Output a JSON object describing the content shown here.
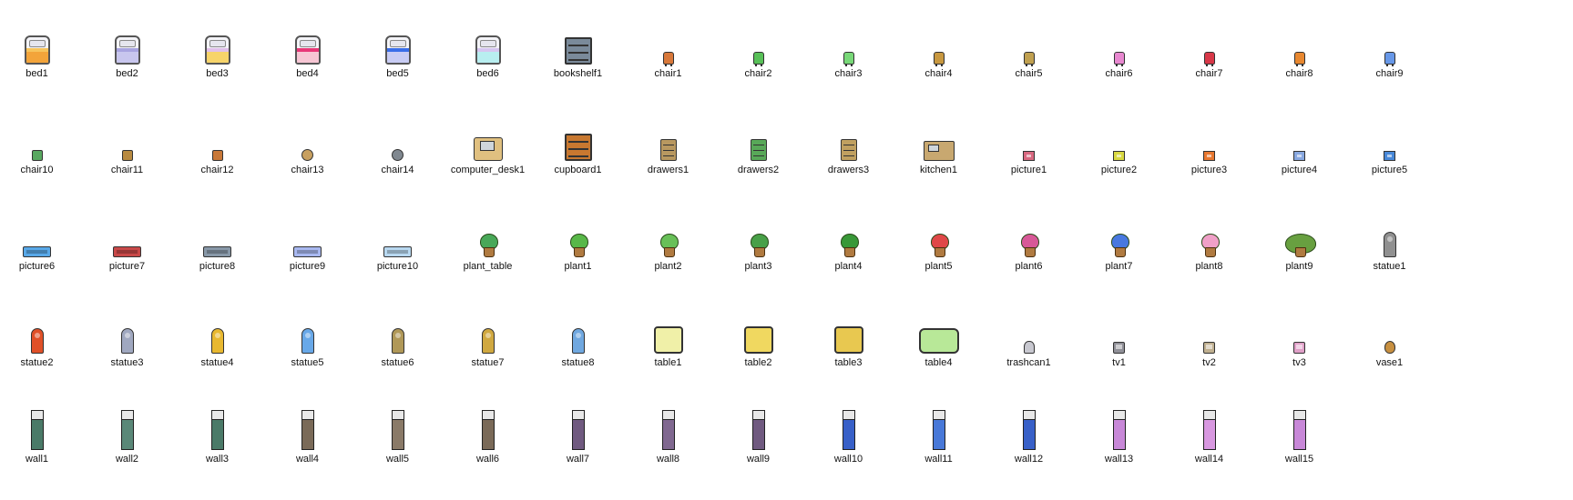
{
  "rows": [
    [
      {
        "label": "bed1",
        "icon": "bed",
        "color": "#f3a43a",
        "accent": "#f7c45c"
      },
      {
        "label": "bed2",
        "icon": "bed",
        "color": "#c8c6ee",
        "accent": "#a8a4e0"
      },
      {
        "label": "bed3",
        "icon": "bed",
        "color": "#f7d46a",
        "accent": "#e0c0ea"
      },
      {
        "label": "bed4",
        "icon": "bed",
        "color": "#f7c6d4",
        "accent": "#e83878"
      },
      {
        "label": "bed5",
        "icon": "bed",
        "color": "#c8ccf4",
        "accent": "#3a6ee8"
      },
      {
        "label": "bed6",
        "icon": "bed",
        "color": "#b8eef0",
        "accent": "#d6c6f0"
      },
      {
        "label": "bookshelf1",
        "icon": "bookshelf",
        "color": "#7a8a9a"
      },
      {
        "label": "chair1",
        "icon": "chair",
        "color": "#d8783a"
      },
      {
        "label": "chair2",
        "icon": "chair",
        "color": "#58c058"
      },
      {
        "label": "chair3",
        "icon": "chair",
        "color": "#78d878"
      },
      {
        "label": "chair4",
        "icon": "chair",
        "color": "#c89840"
      },
      {
        "label": "chair5",
        "icon": "chair",
        "color": "#c0a050"
      },
      {
        "label": "chair6",
        "icon": "chair",
        "color": "#e888d0"
      },
      {
        "label": "chair7",
        "icon": "chair",
        "color": "#d83848"
      },
      {
        "label": "chair8",
        "icon": "chair",
        "color": "#e88830"
      },
      {
        "label": "chair9",
        "icon": "chair",
        "color": "#6898e8"
      }
    ],
    [
      {
        "label": "chair10",
        "icon": "small",
        "color": "#58a860"
      },
      {
        "label": "chair11",
        "icon": "small",
        "color": "#b88a40"
      },
      {
        "label": "chair12",
        "icon": "small",
        "color": "#c87838"
      },
      {
        "label": "chair13",
        "icon": "round",
        "color": "#c8a060"
      },
      {
        "label": "chair14",
        "icon": "round",
        "color": "#808890"
      },
      {
        "label": "computer_desk1",
        "icon": "desk",
        "color": "#e0c080"
      },
      {
        "label": "cupboard1",
        "icon": "shelf",
        "color": "#c87830"
      },
      {
        "label": "drawers1",
        "icon": "cabinet",
        "color": "#b89860"
      },
      {
        "label": "drawers2",
        "icon": "cabinet",
        "color": "#58a858"
      },
      {
        "label": "drawers3",
        "icon": "cabinet",
        "color": "#c0a060"
      },
      {
        "label": "kitchen1",
        "icon": "kitchen",
        "color": "#c8a870"
      },
      {
        "label": "picture1",
        "icon": "frame",
        "color": "#d86880"
      },
      {
        "label": "picture2",
        "icon": "frame",
        "color": "#d8d840"
      },
      {
        "label": "picture3",
        "icon": "frame",
        "color": "#e87830"
      },
      {
        "label": "picture4",
        "icon": "frame",
        "color": "#88a8e0"
      },
      {
        "label": "picture5",
        "icon": "frame",
        "color": "#4888d8"
      }
    ],
    [
      {
        "label": "picture6",
        "icon": "wide",
        "color": "#58a8e8"
      },
      {
        "label": "picture7",
        "icon": "wide",
        "color": "#c84848"
      },
      {
        "label": "picture8",
        "icon": "wide",
        "color": "#8898a8"
      },
      {
        "label": "picture9",
        "icon": "wide",
        "color": "#a8b8f0"
      },
      {
        "label": "picture10",
        "icon": "wide",
        "color": "#b8d8f0"
      },
      {
        "label": "plant_table",
        "icon": "plant",
        "color": "#48a858"
      },
      {
        "label": "plant1",
        "icon": "plant",
        "color": "#58b848"
      },
      {
        "label": "plant2",
        "icon": "plant",
        "color": "#68c058"
      },
      {
        "label": "plant3",
        "icon": "plant",
        "color": "#48a048"
      },
      {
        "label": "plant4",
        "icon": "plant",
        "color": "#389838"
      },
      {
        "label": "plant5",
        "icon": "plant",
        "color": "#e04848"
      },
      {
        "label": "plant6",
        "icon": "plant",
        "color": "#d85898"
      },
      {
        "label": "plant7",
        "icon": "plant",
        "color": "#4878e0"
      },
      {
        "label": "plant8",
        "icon": "plant",
        "color": "#f0a0c8"
      },
      {
        "label": "plant9",
        "icon": "plant-big",
        "color": "#68a040"
      },
      {
        "label": "statue1",
        "icon": "statue",
        "color": "#909090"
      }
    ],
    [
      {
        "label": "statue2",
        "icon": "statue",
        "color": "#e05028"
      },
      {
        "label": "statue3",
        "icon": "statue",
        "color": "#a0a8c0"
      },
      {
        "label": "statue4",
        "icon": "statue",
        "color": "#e8b830"
      },
      {
        "label": "statue5",
        "icon": "statue",
        "color": "#68a8e8"
      },
      {
        "label": "statue6",
        "icon": "statue",
        "color": "#b09858"
      },
      {
        "label": "statue7",
        "icon": "statue",
        "color": "#d0a840"
      },
      {
        "label": "statue8",
        "icon": "statue",
        "color": "#70a8e0"
      },
      {
        "label": "table1",
        "icon": "table",
        "color": "#f0f0a8"
      },
      {
        "label": "table2",
        "icon": "table",
        "color": "#f0d860"
      },
      {
        "label": "table3",
        "icon": "table",
        "color": "#e8c850"
      },
      {
        "label": "table4",
        "icon": "table-wide",
        "color": "#b8e898"
      },
      {
        "label": "trashcan1",
        "icon": "trashcan",
        "color": "#c8c8d0"
      },
      {
        "label": "tv1",
        "icon": "tv",
        "color": "#909098"
      },
      {
        "label": "tv2",
        "icon": "tv",
        "color": "#c0b090"
      },
      {
        "label": "tv3",
        "icon": "tv",
        "color": "#e0a0c8"
      },
      {
        "label": "vase1",
        "icon": "vase",
        "color": "#c89040"
      }
    ],
    [
      {
        "label": "wall1",
        "icon": "wall",
        "color": "#4a7a68"
      },
      {
        "label": "wall2",
        "icon": "wall",
        "color": "#5a8878"
      },
      {
        "label": "wall3",
        "icon": "wall",
        "color": "#4a7a68"
      },
      {
        "label": "wall4",
        "icon": "wall",
        "color": "#7a6a58"
      },
      {
        "label": "wall5",
        "icon": "wall",
        "color": "#8a7a68"
      },
      {
        "label": "wall6",
        "icon": "wall",
        "color": "#7a6a58"
      },
      {
        "label": "wall7",
        "icon": "wall",
        "color": "#705a80"
      },
      {
        "label": "wall8",
        "icon": "wall",
        "color": "#806890"
      },
      {
        "label": "wall9",
        "icon": "wall",
        "color": "#705a80"
      },
      {
        "label": "wall10",
        "icon": "wall",
        "color": "#3860c8"
      },
      {
        "label": "wall11",
        "icon": "wall",
        "color": "#4878d8"
      },
      {
        "label": "wall12",
        "icon": "wall",
        "color": "#3860c8"
      },
      {
        "label": "wall13",
        "icon": "wall",
        "color": "#c888d8"
      },
      {
        "label": "wall14",
        "icon": "wall",
        "color": "#d898e0"
      },
      {
        "label": "wall15",
        "icon": "wall",
        "color": "#c888d8"
      }
    ]
  ]
}
